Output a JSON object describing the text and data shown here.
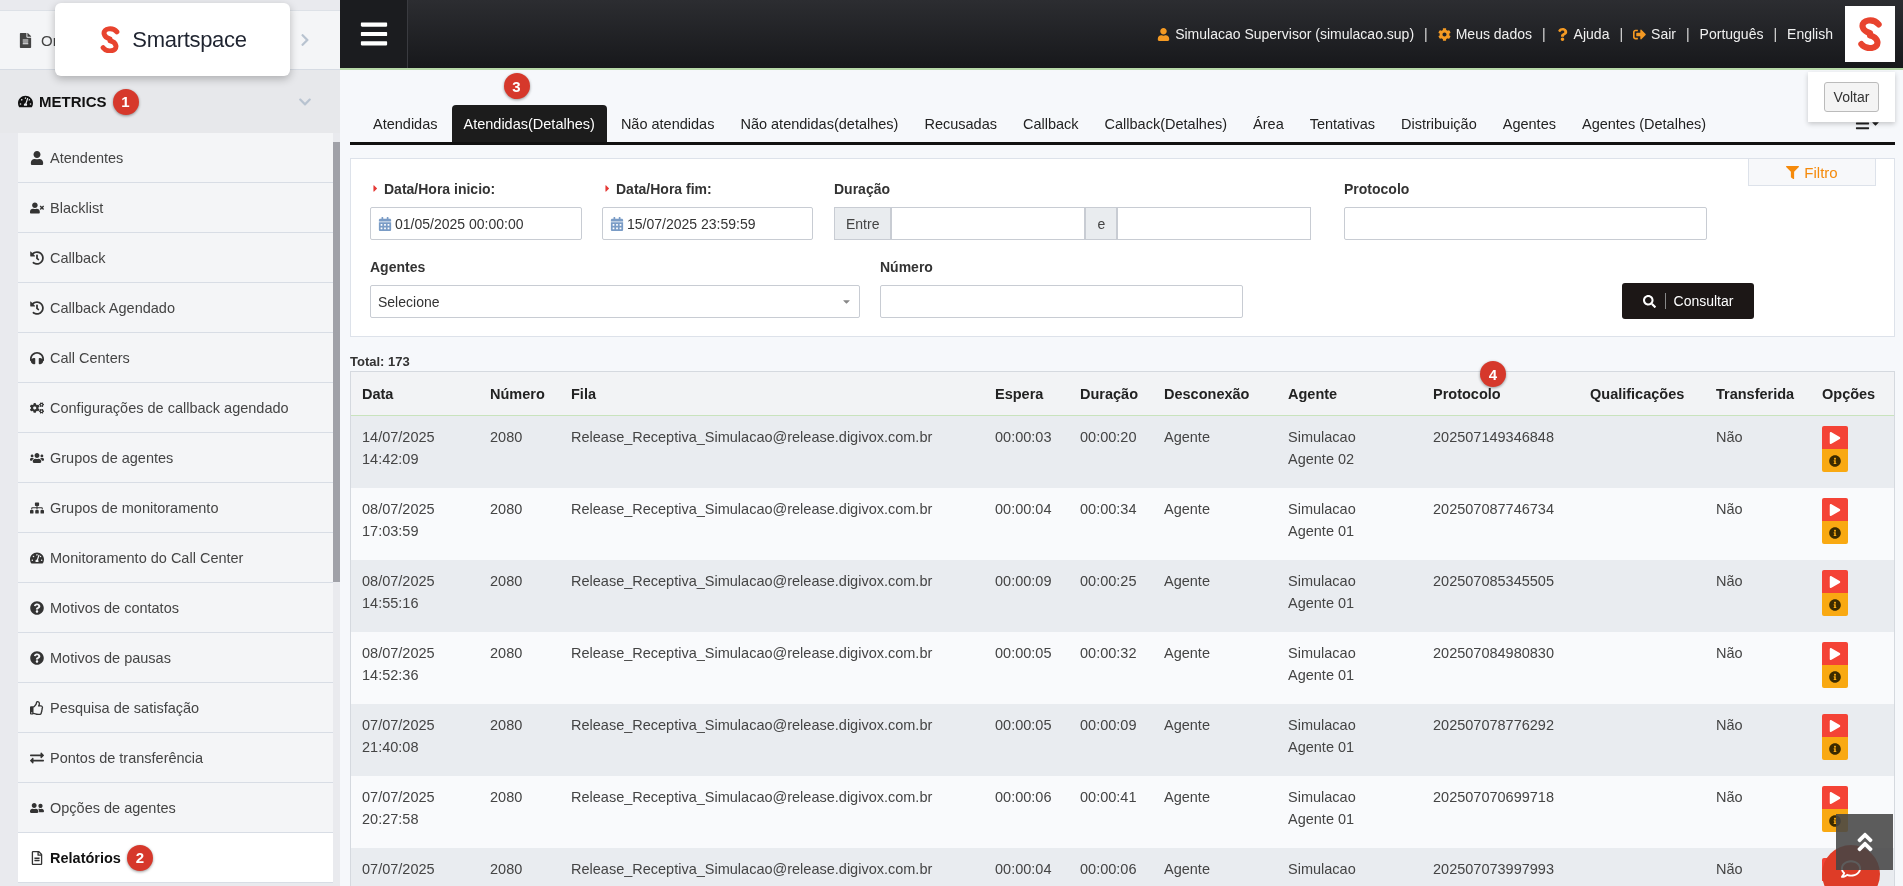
{
  "logo": {
    "text": "Smartspace"
  },
  "sidebar": {
    "top_item": {
      "label": "Or"
    },
    "section": {
      "label": "METRICS",
      "expanded": true,
      "badge": "1"
    },
    "items": [
      {
        "label": "Atendentes",
        "selected": false
      },
      {
        "label": "Blacklist",
        "selected": false
      },
      {
        "label": "Callback",
        "selected": false
      },
      {
        "label": "Callback Agendado",
        "selected": false
      },
      {
        "label": "Call Centers",
        "selected": false
      },
      {
        "label": "Configurações de callback agendado",
        "selected": false
      },
      {
        "label": "Grupos de agentes",
        "selected": false
      },
      {
        "label": "Grupos de monitoramento",
        "selected": false
      },
      {
        "label": "Monitoramento do Call Center",
        "selected": false
      },
      {
        "label": "Motivos de contatos",
        "selected": false
      },
      {
        "label": "Motivos de pausas",
        "selected": false
      },
      {
        "label": "Pesquisa de satisfação",
        "selected": false
      },
      {
        "label": "Pontos de transferência",
        "selected": false
      },
      {
        "label": "Opções de agentes",
        "selected": false
      },
      {
        "label": "Relatórios",
        "selected": true,
        "badge": "2"
      }
    ]
  },
  "topbar": {
    "separator": "|",
    "links": [
      {
        "kind": "user",
        "label": "Simulacao Supervisor (simulacao.sup)"
      },
      {
        "kind": "settings",
        "label": "Meus dados"
      },
      {
        "kind": "help",
        "label": "Ajuda"
      },
      {
        "kind": "logout",
        "label": "Sair"
      },
      {
        "kind": "language",
        "label": "Português"
      },
      {
        "kind": "language",
        "label": "English"
      }
    ]
  },
  "back_button": "Voltar",
  "tabs": [
    {
      "label": "Atendidas",
      "selected": false
    },
    {
      "label": "Atendidas(Detalhes)",
      "selected": true,
      "badge": "3"
    },
    {
      "label": "Não atendidas",
      "selected": false
    },
    {
      "label": "Não atendidas(detalhes)",
      "selected": false
    },
    {
      "label": "Recusadas",
      "selected": false
    },
    {
      "label": "Callback",
      "selected": false
    },
    {
      "label": "Callback(Detalhes)",
      "selected": false
    },
    {
      "label": "Área",
      "selected": false
    },
    {
      "label": "Tentativas",
      "selected": false
    },
    {
      "label": "Distribuição",
      "selected": false
    },
    {
      "label": "Agentes",
      "selected": false
    },
    {
      "label": "Agentes (Detalhes)",
      "selected": false
    }
  ],
  "filter": {
    "toggle": "Filtro",
    "submit": "Consultar",
    "fields": [
      {
        "kind": "date",
        "label": "Data/Hora inicio:",
        "required": true,
        "value": "01/05/2025 00:00:00"
      },
      {
        "kind": "date",
        "label": "Data/Hora fim:",
        "required": true,
        "value": "15/07/2025 23:59:59"
      },
      {
        "kind": "range",
        "label": "Duração",
        "prefix": "Entre",
        "middle": "e"
      },
      {
        "kind": "text",
        "label": "Protocolo"
      },
      {
        "kind": "select",
        "label": "Agentes",
        "value": "Selecione"
      },
      {
        "kind": "text",
        "label": "Número"
      }
    ]
  },
  "total": "Total: 173",
  "table": {
    "columns": [
      {
        "label": "Data"
      },
      {
        "label": "Número"
      },
      {
        "label": "Fila"
      },
      {
        "label": "Espera"
      },
      {
        "label": "Duração"
      },
      {
        "label": "Desconexão"
      },
      {
        "label": "Agente"
      },
      {
        "label": "Protocolo",
        "badge": "4"
      },
      {
        "label": "Qualificações"
      },
      {
        "label": "Transferida"
      },
      {
        "label": "Opções"
      }
    ],
    "rows": [
      {
        "data": "14/07/2025 14:42:09",
        "numero": "2080",
        "fila": "Release_Receptiva_Simulacao@release.digivox.com.br",
        "espera": "00:00:03",
        "duracao": "00:00:20",
        "desconexao": "Agente",
        "agente": "Simulacao Agente 02",
        "protocolo": "202507149346848",
        "transferida": "Não"
      },
      {
        "data": "08/07/2025 17:03:59",
        "numero": "2080",
        "fila": "Release_Receptiva_Simulacao@release.digivox.com.br",
        "espera": "00:00:04",
        "duracao": "00:00:34",
        "desconexao": "Agente",
        "agente": "Simulacao Agente 01",
        "protocolo": "202507087746734",
        "transferida": "Não"
      },
      {
        "data": "08/07/2025 14:55:16",
        "numero": "2080",
        "fila": "Release_Receptiva_Simulacao@release.digivox.com.br",
        "espera": "00:00:09",
        "duracao": "00:00:25",
        "desconexao": "Agente",
        "agente": "Simulacao Agente 01",
        "protocolo": "202507085345505",
        "transferida": "Não"
      },
      {
        "data": "08/07/2025 14:52:36",
        "numero": "2080",
        "fila": "Release_Receptiva_Simulacao@release.digivox.com.br",
        "espera": "00:00:05",
        "duracao": "00:00:32",
        "desconexao": "Agente",
        "agente": "Simulacao Agente 01",
        "protocolo": "202507084980830",
        "transferida": "Não"
      },
      {
        "data": "07/07/2025 21:40:08",
        "numero": "2080",
        "fila": "Release_Receptiva_Simulacao@release.digivox.com.br",
        "espera": "00:00:05",
        "duracao": "00:00:09",
        "desconexao": "Agente",
        "agente": "Simulacao Agente 01",
        "protocolo": "202507078776292",
        "transferida": "Não"
      },
      {
        "data": "07/07/2025 20:27:58",
        "numero": "2080",
        "fila": "Release_Receptiva_Simulacao@release.digivox.com.br",
        "espera": "00:00:06",
        "duracao": "00:00:41",
        "desconexao": "Agente",
        "agente": "Simulacao Agente 01",
        "protocolo": "202507070699718",
        "transferida": "Não"
      },
      {
        "data": "07/07/2025",
        "numero": "2080",
        "fila": "Release_Receptiva_Simulacao@release.digivox.com.br",
        "espera": "00:00:04",
        "duracao": "00:00:06",
        "desconexao": "Agente",
        "agente": "Simulacao",
        "protocolo": "202507073997993",
        "transferida": "Não"
      }
    ]
  }
}
